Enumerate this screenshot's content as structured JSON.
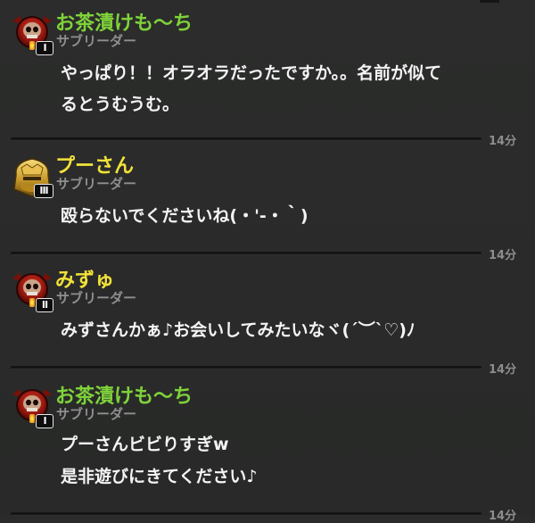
{
  "colors": {
    "name_green": "#7fd23a",
    "name_yellow": "#f2e13a",
    "body_text": "#f4f4f4",
    "role_text": "#8e8f8e",
    "timestamp_text": "#8c8d8c"
  },
  "messages": [
    {
      "author": "お茶漬けも〜ち",
      "name_color": "#7fd23a",
      "role": "サブリーダー",
      "avatar_icon": "red-skull-badge-icon",
      "rank_badge": "I",
      "lines": [
        "やっぱり！！オラオラだったですか。。名前が似て",
        "るとうむうむ。"
      ]
    },
    {
      "author": "プーさん",
      "name_color": "#f2e13a",
      "role": "サブリーダー",
      "avatar_icon": "gold-helmet-badge-icon",
      "rank_badge": "III",
      "lines": [
        "殴らないでくださいね(・'-・｀)"
      ]
    },
    {
      "author": "みずゅ",
      "name_color": "#f2e13a",
      "role": "サブリーダー",
      "avatar_icon": "red-skull-badge-icon",
      "rank_badge": "II",
      "lines": [
        "みずさんかぁ♪お会いしてみたいなヾ(´︶`♡)ﾉ"
      ]
    },
    {
      "author": "お茶漬けも〜ち",
      "name_color": "#7fd23a",
      "role": "サブリーダー",
      "avatar_icon": "red-skull-badge-icon",
      "rank_badge": "I",
      "lines": [
        "プーさんビビりすぎw",
        "是非遊びにきてください♪"
      ]
    }
  ],
  "separators": [
    {
      "time": "14分"
    },
    {
      "time": "14分"
    },
    {
      "time": "14分"
    },
    {
      "time": "14分"
    }
  ]
}
